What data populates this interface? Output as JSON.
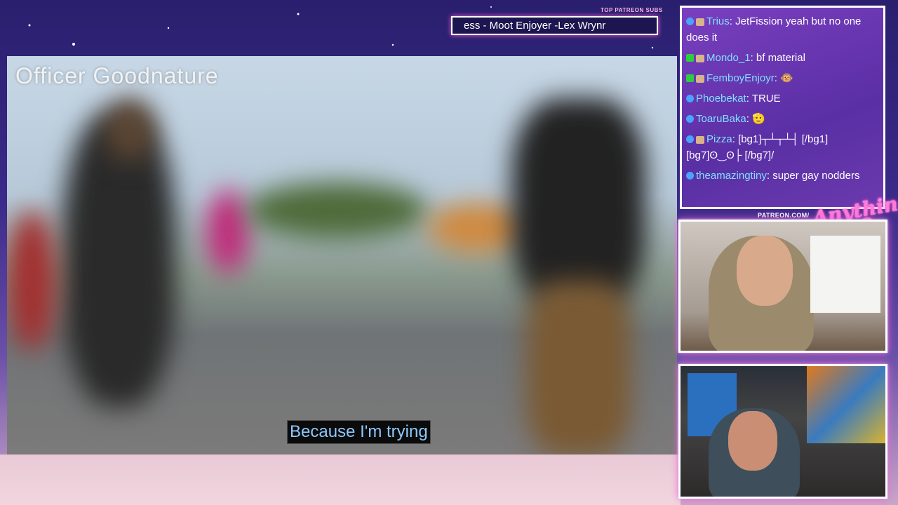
{
  "stream": {
    "video_title": "Officer Goodnature",
    "caption": "Because I'm trying",
    "patreon_top_label": "TOP PATREON SUBS",
    "ticker_text": "ess - Moot Enjoyer -Lex Wrynr",
    "patreon_url": "PATREON.COM/",
    "brand_text": "Anything Else?"
  },
  "chat": {
    "messages": [
      {
        "user": "Trius",
        "text": ": JetFission yeah but no one does it"
      },
      {
        "user": "Mondo_1",
        "text": ": bf material"
      },
      {
        "user": "FemboyEnjoyr",
        "text": ": 🐵"
      },
      {
        "user": "Phoebekat",
        "text": ": TRUE"
      },
      {
        "user": "ToaruBaka",
        "text": ": 🫡"
      },
      {
        "user": "Pizza",
        "text": ": [bg1]┬┴┬┴┤ [/bg1] [bg7]ʘ‿ʘ├ [/bg7]/"
      },
      {
        "user": "theamazingtiny",
        "text": ": super gay nodders"
      }
    ]
  },
  "colors": {
    "chat_username": "#7ee0ff",
    "caption_text": "#8ec8ff",
    "neon_pink": "#ff5fd2"
  }
}
